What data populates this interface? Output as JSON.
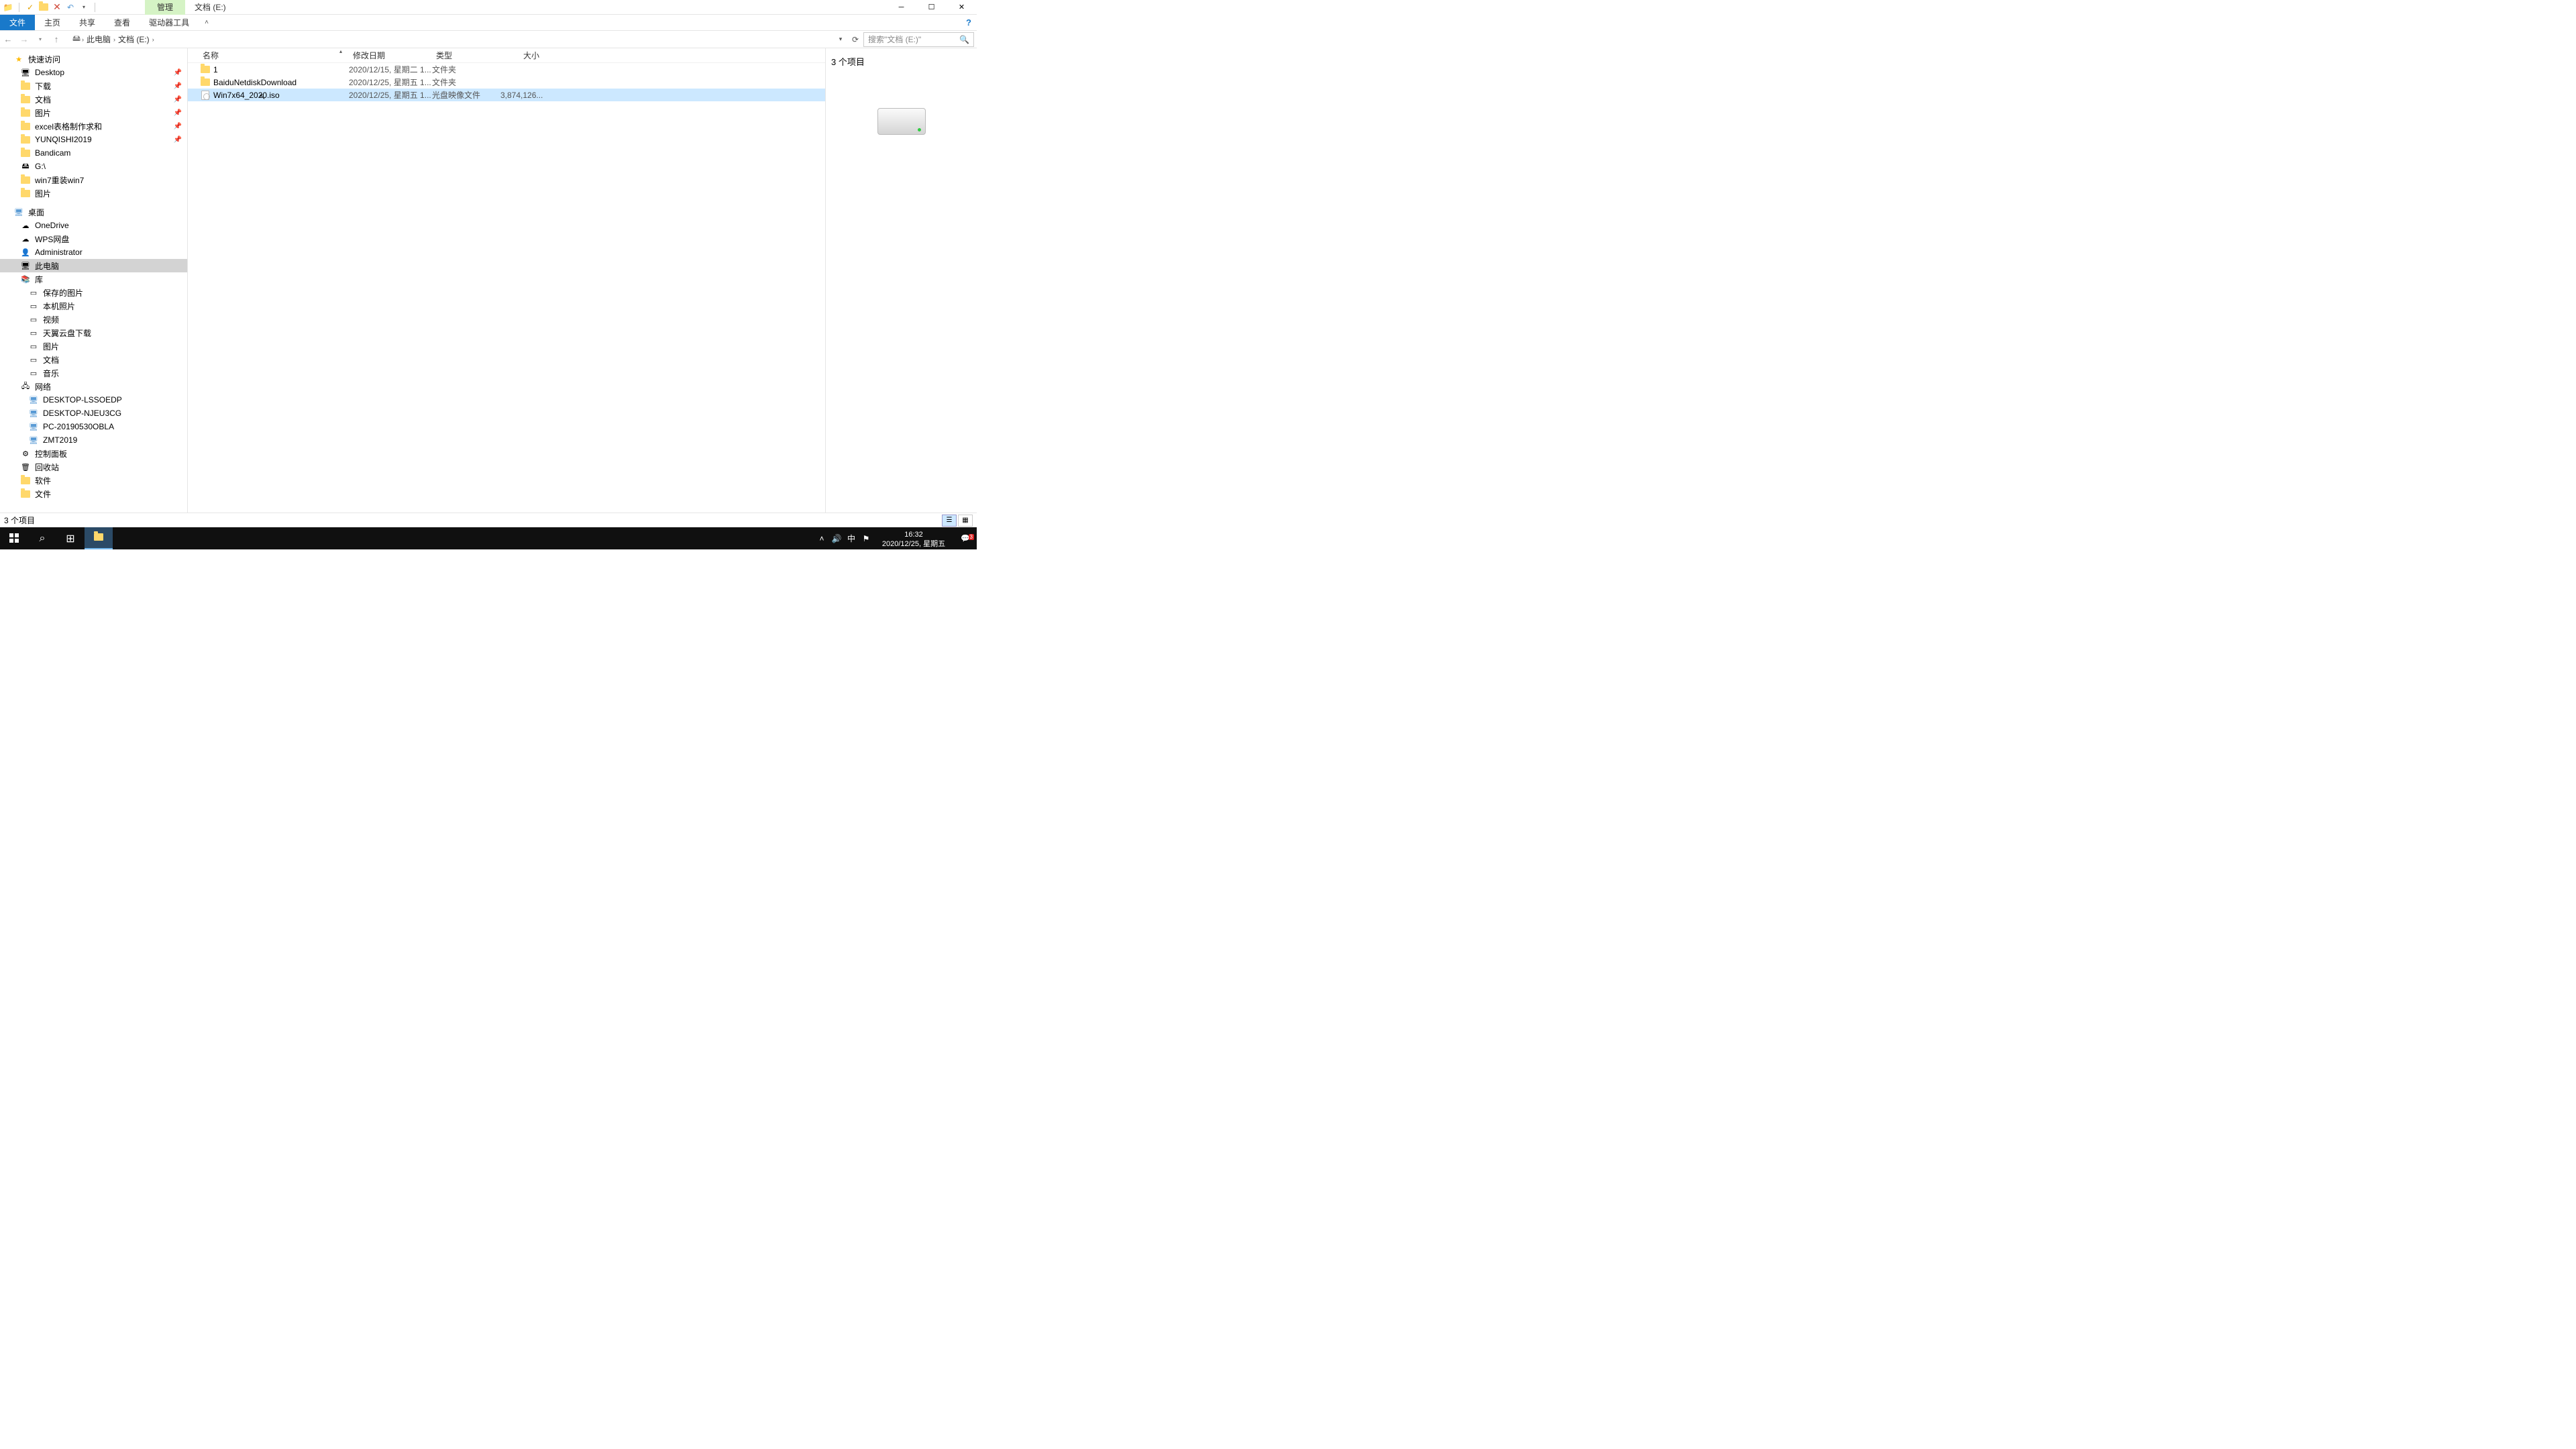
{
  "titlebar": {
    "context_tab": "管理",
    "window_title": "文档 (E:)"
  },
  "ribbon": {
    "file": "文件",
    "home": "主页",
    "share": "共享",
    "view": "查看",
    "drive_tools": "驱动器工具"
  },
  "breadcrumb": {
    "this_pc": "此电脑",
    "location": "文档 (E:)"
  },
  "search": {
    "placeholder": "搜索\"文档 (E:)\""
  },
  "columns": {
    "name": "名称",
    "date": "修改日期",
    "type": "类型",
    "size": "大小"
  },
  "files": [
    {
      "name": "1",
      "date": "2020/12/15, 星期二 1...",
      "type": "文件夹",
      "size": "",
      "icon": "folder",
      "selected": false
    },
    {
      "name": "BaiduNetdiskDownload",
      "date": "2020/12/25, 星期五 1...",
      "type": "文件夹",
      "size": "",
      "icon": "folder",
      "selected": false
    },
    {
      "name": "Win7x64_2020.iso",
      "date": "2020/12/25, 星期五 1...",
      "type": "光盘映像文件",
      "size": "3,874,126...",
      "icon": "iso",
      "selected": true
    }
  ],
  "nav": {
    "quick_access": "快速访问",
    "qa_items": [
      {
        "label": "Desktop",
        "pin": true,
        "icon": "desktop"
      },
      {
        "label": "下载",
        "pin": true,
        "icon": "folder"
      },
      {
        "label": "文档",
        "pin": true,
        "icon": "folder"
      },
      {
        "label": "图片",
        "pin": true,
        "icon": "folder"
      },
      {
        "label": "excel表格制作求和",
        "pin": true,
        "icon": "folder"
      },
      {
        "label": "YUNQISHI2019",
        "pin": true,
        "icon": "folder"
      },
      {
        "label": "Bandicam",
        "pin": false,
        "icon": "folder"
      },
      {
        "label": "G:\\",
        "pin": false,
        "icon": "drive"
      },
      {
        "label": "win7重装win7",
        "pin": false,
        "icon": "folder"
      },
      {
        "label": "图片",
        "pin": false,
        "icon": "folder"
      }
    ],
    "desktop": "桌面",
    "desktop_items": [
      {
        "label": "OneDrive",
        "icon": "cloud"
      },
      {
        "label": "WPS网盘",
        "icon": "cloud"
      },
      {
        "label": "Administrator",
        "icon": "user"
      },
      {
        "label": "此电脑",
        "icon": "pc",
        "selected": true
      },
      {
        "label": "库",
        "icon": "library"
      }
    ],
    "library_items": [
      {
        "label": "保存的图片"
      },
      {
        "label": "本机照片"
      },
      {
        "label": "视频"
      },
      {
        "label": "天翼云盘下载"
      },
      {
        "label": "图片"
      },
      {
        "label": "文档"
      },
      {
        "label": "音乐"
      }
    ],
    "network": "网络",
    "network_items": [
      {
        "label": "DESKTOP-LSSOEDP"
      },
      {
        "label": "DESKTOP-NJEU3CG"
      },
      {
        "label": "PC-20190530OBLA"
      },
      {
        "label": "ZMT2019"
      }
    ],
    "control_panel": "控制面板",
    "recycle": "回收站",
    "software": "软件",
    "files_folder": "文件"
  },
  "preview": {
    "count_label": "3 个项目"
  },
  "status": {
    "text": "3 个项目"
  },
  "taskbar": {
    "time": "16:32",
    "date": "2020/12/25, 星期五",
    "ime": "中",
    "notify_count": "3"
  }
}
